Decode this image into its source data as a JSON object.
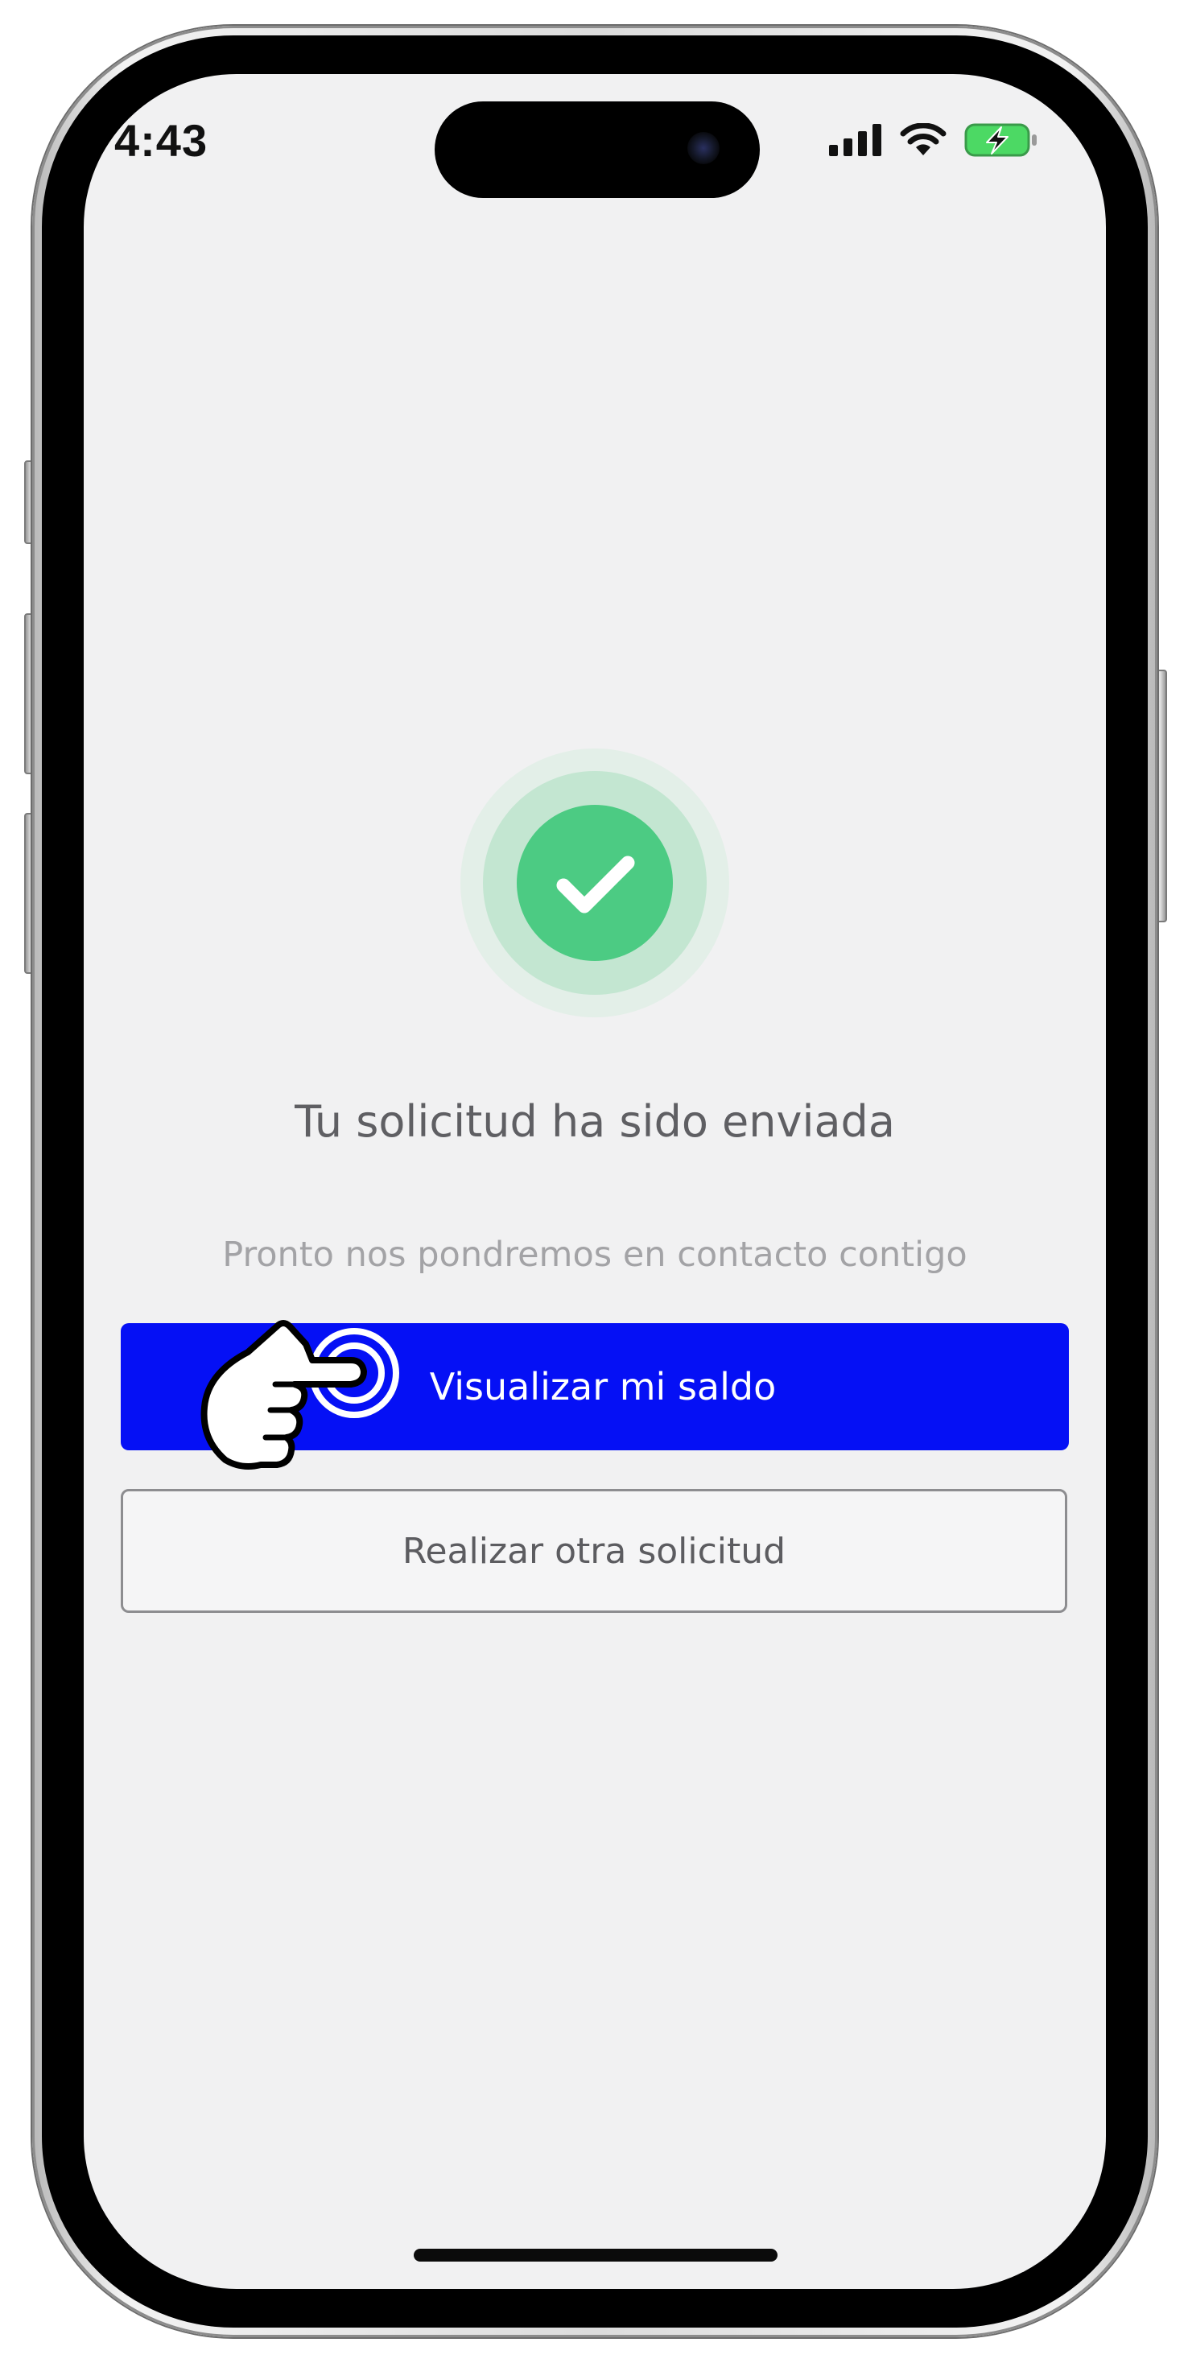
{
  "status_bar": {
    "time": "4:43",
    "icons": [
      "cellular-signal-icon",
      "wifi-icon",
      "battery-charging-icon"
    ]
  },
  "success": {
    "icon": "checkmark-icon",
    "title": "Tu solicitud ha sido enviada",
    "subtitle": "Pronto nos pondremos en contacto contigo"
  },
  "actions": {
    "primary_label": "Visualizar mi saldo",
    "secondary_label": "Realizar otra solicitud"
  },
  "overlay": {
    "pointer_icon": "tap-hand-icon"
  },
  "colors": {
    "primary_button": "#0510f5",
    "success_green": "#4ccb83",
    "battery_green": "#4cd964",
    "screen_bg": "#f1f1f2"
  }
}
